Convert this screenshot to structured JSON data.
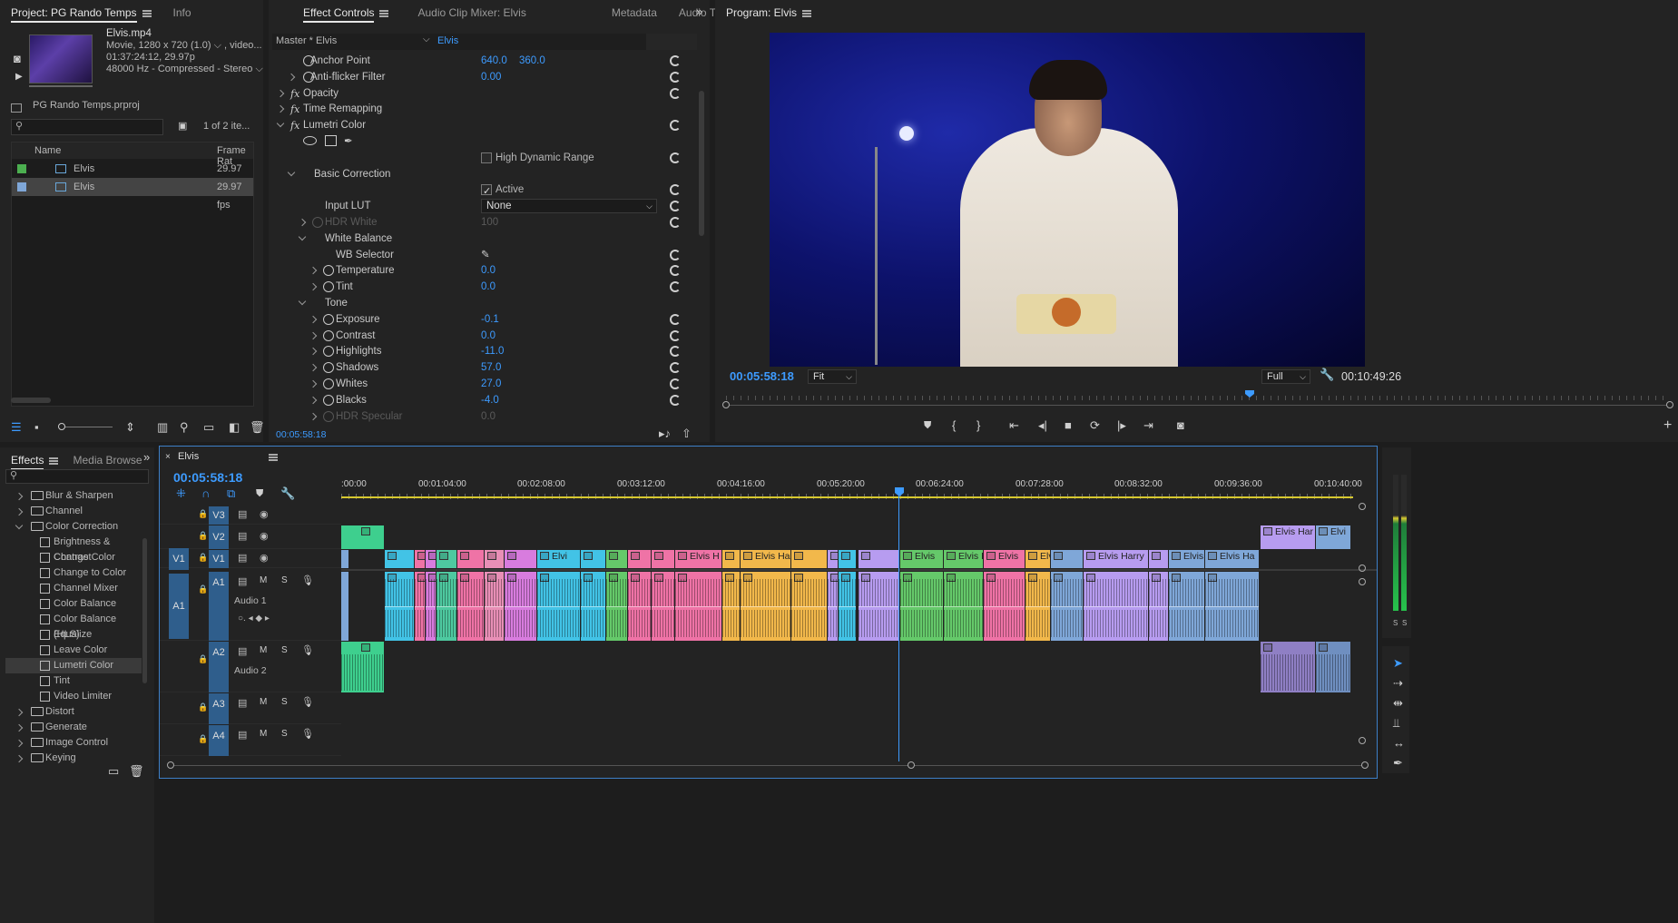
{
  "project": {
    "tab_label": "Project: PG Rando Temps",
    "info_tab": "Info",
    "clip_name": "Elvis.mp4",
    "clip_line1": "Movie, 1280 x 720 (1.0) ⌵ , video...",
    "clip_line2": "01:37:24:12, 29.97p",
    "clip_line3": "48000 Hz - Compressed - Stereo ⌵",
    "file_name": "PG Rando Temps.prproj",
    "item_count": "1 of 2 ite...",
    "col_name": "Name",
    "col_rate": "Frame Rat",
    "items": [
      {
        "name": "Elvis",
        "rate": "29.97 fps",
        "color": "#4caf50"
      },
      {
        "name": "Elvis",
        "rate": "29.97 fps",
        "color": "#7fa7d8"
      }
    ]
  },
  "effect_controls": {
    "tabs": [
      "Effect Controls",
      "Audio Clip Mixer: Elvis",
      "Metadata",
      "Audio Ti"
    ],
    "master": "Master * Elvis",
    "sequence": "Elvis",
    "rows": [
      {
        "label": "Anchor Point",
        "v1": "640.0",
        "v2": "360.0"
      },
      {
        "label": "Anti-flicker Filter",
        "v1": "0.00",
        "v2": ""
      },
      {
        "label": "Opacity",
        "v1": "",
        "v2": ""
      },
      {
        "label": "Time Remapping",
        "v1": "",
        "v2": ""
      },
      {
        "label": "Lumetri Color",
        "v1": "",
        "v2": ""
      },
      {
        "label": "",
        "v1": "",
        "v2": ""
      },
      {
        "label": "",
        "v1": "High Dynamic Range",
        "v2": ""
      },
      {
        "label": "Basic Correction",
        "v1": "",
        "v2": ""
      },
      {
        "label": "",
        "v1": "Active",
        "v2": ""
      },
      {
        "label": "Input LUT",
        "v1": "None",
        "v2": ""
      },
      {
        "label": "HDR White",
        "v1": "100",
        "v2": ""
      },
      {
        "label": "White Balance",
        "v1": "",
        "v2": ""
      },
      {
        "label": "WB Selector",
        "v1": "",
        "v2": ""
      },
      {
        "label": "Temperature",
        "v1": "0.0",
        "v2": ""
      },
      {
        "label": "Tint",
        "v1": "0.0",
        "v2": ""
      },
      {
        "label": "Tone",
        "v1": "",
        "v2": ""
      },
      {
        "label": "Exposure",
        "v1": "-0.1",
        "v2": ""
      },
      {
        "label": "Contrast",
        "v1": "0.0",
        "v2": ""
      },
      {
        "label": "Highlights",
        "v1": "-11.0",
        "v2": ""
      },
      {
        "label": "Shadows",
        "v1": "57.0",
        "v2": ""
      },
      {
        "label": "Whites",
        "v1": "27.0",
        "v2": ""
      },
      {
        "label": "Blacks",
        "v1": "-4.0",
        "v2": ""
      },
      {
        "label": "HDR Specular",
        "v1": "0.0",
        "v2": ""
      }
    ],
    "timecode": "00:05:58:18"
  },
  "program": {
    "tab_label": "Program: Elvis",
    "timecode": "00:05:58:18",
    "fit": "Fit",
    "quality": "Full",
    "duration": "00:10:49:26",
    "playhead_fraction": 0.55
  },
  "effects": {
    "tab_label": "Effects",
    "media_browser": "Media Browse",
    "items": [
      {
        "label": "Blur & Sharpen",
        "type": "folder",
        "indent": 0
      },
      {
        "label": "Channel",
        "type": "folder",
        "indent": 0
      },
      {
        "label": "Color Correction",
        "type": "folder-open",
        "indent": 0
      },
      {
        "label": "Brightness & Contrast",
        "type": "fx",
        "indent": 1
      },
      {
        "label": "Change Color",
        "type": "fx",
        "indent": 1
      },
      {
        "label": "Change to Color",
        "type": "fx",
        "indent": 1
      },
      {
        "label": "Channel Mixer",
        "type": "fx",
        "indent": 1
      },
      {
        "label": "Color Balance",
        "type": "fx",
        "indent": 1
      },
      {
        "label": "Color Balance (HLS)",
        "type": "fx",
        "indent": 1
      },
      {
        "label": "Equalize",
        "type": "fx",
        "indent": 1
      },
      {
        "label": "Leave Color",
        "type": "fx",
        "indent": 1
      },
      {
        "label": "Lumetri Color",
        "type": "fx-selected",
        "indent": 1
      },
      {
        "label": "Tint",
        "type": "fx",
        "indent": 1
      },
      {
        "label": "Video Limiter",
        "type": "fx",
        "indent": 1
      },
      {
        "label": "Distort",
        "type": "folder",
        "indent": 0
      },
      {
        "label": "Generate",
        "type": "folder",
        "indent": 0
      },
      {
        "label": "Image Control",
        "type": "folder",
        "indent": 0
      },
      {
        "label": "Keying",
        "type": "folder",
        "indent": 0
      }
    ]
  },
  "timeline": {
    "tab_label": "Elvis",
    "timecode": "00:05:58:18",
    "ruler": [
      ":00:00",
      "00:01:04:00",
      "00:02:08:00",
      "00:03:12:00",
      "00:04:16:00",
      "00:05:20:00",
      "00:06:24:00",
      "00:07:28:00",
      "00:08:32:00",
      "00:09:36:00",
      "00:10:40:00"
    ],
    "tracks": {
      "v3": "V3",
      "v2": "V2",
      "v1": "V1",
      "v1src": "V1",
      "a1": "A1",
      "a1src": "A1",
      "a2": "A2",
      "a3": "A3",
      "a4": "A4",
      "audio1": "Audio 1",
      "audio2": "Audio 2",
      "m": "M",
      "s": "S"
    },
    "clip_labels": [
      "Elvi",
      "Elvis H",
      "Elvis Ha",
      "Elvi",
      "Elvis",
      "Elvis H",
      "Elvis",
      "Elvis",
      "Elvis Harry",
      "Elvis",
      "Elvis Ha",
      "Elvis Har",
      "Elvi"
    ]
  },
  "meter": {
    "left": "S",
    "right": "S"
  }
}
